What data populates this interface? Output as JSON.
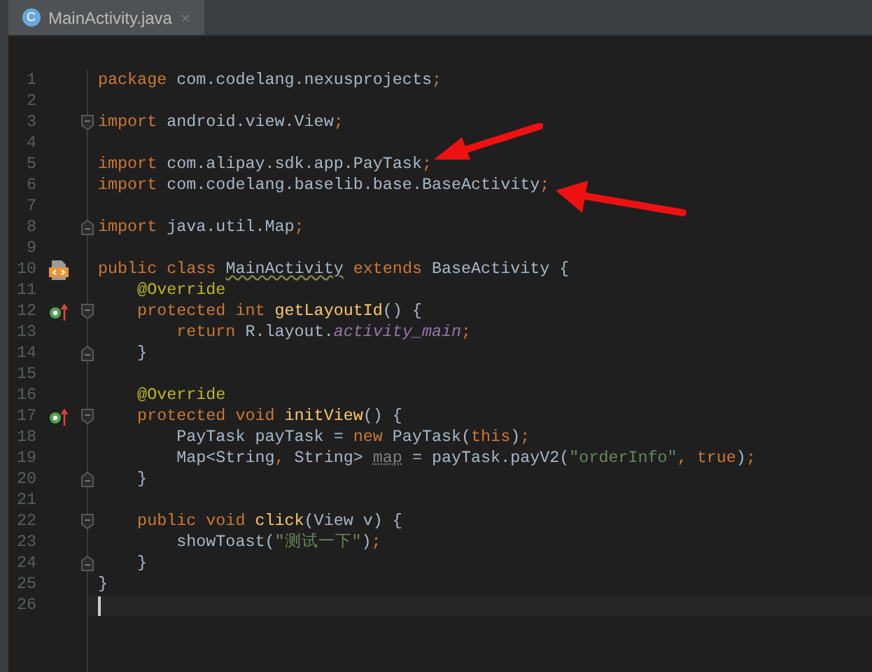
{
  "tab": {
    "icon_text": "C",
    "title": "MainActivity.java",
    "close": "×",
    "selected": true
  },
  "lines": [
    {
      "n": "1",
      "tokens": [
        {
          "kind": "keyword",
          "text": "package"
        },
        {
          "kind": "plain",
          "text": " com.codelang.nexusprojects"
        },
        {
          "kind": "punct",
          "text": ";"
        }
      ]
    },
    {
      "n": "2"
    },
    {
      "n": "3",
      "fold_start": true,
      "tokens": [
        {
          "kind": "keyword",
          "text": "import"
        },
        {
          "kind": "plain",
          "text": " android.view.View"
        },
        {
          "kind": "punct",
          "text": ";"
        }
      ]
    },
    {
      "n": "4"
    },
    {
      "n": "5",
      "tokens": [
        {
          "kind": "keyword",
          "text": "import"
        },
        {
          "kind": "plain",
          "text": " com.alipay.sdk.app.PayTask"
        },
        {
          "kind": "punct",
          "text": ";"
        }
      ]
    },
    {
      "n": "6",
      "tokens": [
        {
          "kind": "keyword",
          "text": "import"
        },
        {
          "kind": "plain",
          "text": " com.codelang.baselib.base.BaseActivity"
        },
        {
          "kind": "punct",
          "text": ";"
        }
      ]
    },
    {
      "n": "7"
    },
    {
      "n": "8",
      "fold_end": true,
      "tokens": [
        {
          "kind": "keyword",
          "text": "import"
        },
        {
          "kind": "plain",
          "text": " java.util.Map"
        },
        {
          "kind": "punct",
          "text": ";"
        }
      ]
    },
    {
      "n": "9"
    },
    {
      "n": "10",
      "class_marker": true,
      "tokens": [
        {
          "kind": "keyword",
          "text": "public class "
        },
        {
          "kind": "warning",
          "text": "MainActivity"
        },
        {
          "kind": "keyword",
          "text": " extends "
        },
        {
          "kind": "plain",
          "text": "BaseActivity {"
        }
      ]
    },
    {
      "n": "11",
      "tokens": [
        {
          "kind": "annotation",
          "text": "    @Override"
        }
      ]
    },
    {
      "n": "12",
      "override": true,
      "fold_start": true,
      "tokens": [
        {
          "kind": "keyword",
          "text": "    protected int "
        },
        {
          "kind": "method",
          "text": "getLayoutId"
        },
        {
          "kind": "plain",
          "text": "() {"
        }
      ]
    },
    {
      "n": "13",
      "tokens": [
        {
          "kind": "keyword",
          "text": "        return "
        },
        {
          "kind": "plain",
          "text": "R.layout."
        },
        {
          "kind": "field",
          "text": "activity_main"
        },
        {
          "kind": "punct",
          "text": ";"
        }
      ]
    },
    {
      "n": "14",
      "fold_end": true,
      "tokens": [
        {
          "kind": "plain",
          "text": "    }"
        }
      ]
    },
    {
      "n": "15"
    },
    {
      "n": "16",
      "tokens": [
        {
          "kind": "annotation",
          "text": "    @Override"
        }
      ]
    },
    {
      "n": "17",
      "override": true,
      "fold_start": true,
      "tokens": [
        {
          "kind": "keyword",
          "text": "    protected void "
        },
        {
          "kind": "method",
          "text": "initView"
        },
        {
          "kind": "plain",
          "text": "() {"
        }
      ]
    },
    {
      "n": "18",
      "tokens": [
        {
          "kind": "plain",
          "text": "        PayTask payTask = "
        },
        {
          "kind": "keyword",
          "text": "new "
        },
        {
          "kind": "plain",
          "text": "PayTask("
        },
        {
          "kind": "keyword",
          "text": "this"
        },
        {
          "kind": "plain",
          "text": ")"
        },
        {
          "kind": "punct",
          "text": ";"
        }
      ]
    },
    {
      "n": "19",
      "tokens": [
        {
          "kind": "plain",
          "text": "        Map<String"
        },
        {
          "kind": "punct",
          "text": ", "
        },
        {
          "kind": "plain",
          "text": "String> "
        },
        {
          "kind": "unused",
          "text": "map"
        },
        {
          "kind": "plain",
          "text": " = payTask.payV2("
        },
        {
          "kind": "string",
          "text": "\"orderInfo\""
        },
        {
          "kind": "punct",
          "text": ", "
        },
        {
          "kind": "keyword",
          "text": "true"
        },
        {
          "kind": "plain",
          "text": ")"
        },
        {
          "kind": "punct",
          "text": ";"
        }
      ]
    },
    {
      "n": "20",
      "fold_end": true,
      "tokens": [
        {
          "kind": "plain",
          "text": "    }"
        }
      ]
    },
    {
      "n": "21"
    },
    {
      "n": "22",
      "fold_start": true,
      "tokens": [
        {
          "kind": "keyword",
          "text": "    public void "
        },
        {
          "kind": "method",
          "text": "click"
        },
        {
          "kind": "plain",
          "text": "(View v) {"
        }
      ]
    },
    {
      "n": "23",
      "tokens": [
        {
          "kind": "plain",
          "text": "        showToast("
        },
        {
          "kind": "string",
          "text": "\"测试一下\""
        },
        {
          "kind": "plain",
          "text": ")"
        },
        {
          "kind": "punct",
          "text": ";"
        }
      ]
    },
    {
      "n": "24",
      "fold_end": true,
      "tokens": [
        {
          "kind": "plain",
          "text": "    }"
        }
      ]
    },
    {
      "n": "25",
      "tokens": [
        {
          "kind": "plain",
          "text": "}"
        }
      ]
    },
    {
      "n": "26",
      "current": true
    }
  ]
}
